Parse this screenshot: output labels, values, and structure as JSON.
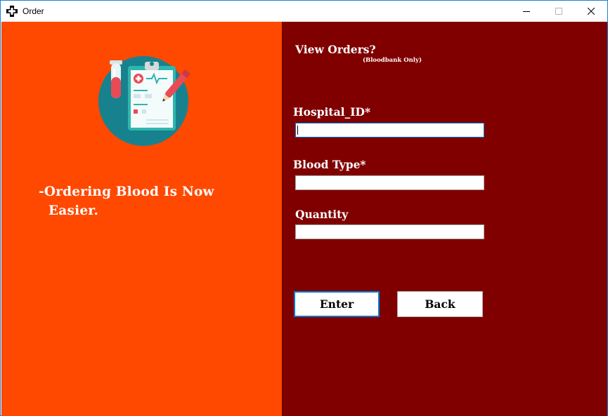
{
  "window": {
    "title": "Order",
    "icon": "medical-cross-icon",
    "controls": [
      "minimize-icon",
      "maximize-icon",
      "close-icon"
    ]
  },
  "left_panel": {
    "background": "#ff4800",
    "illustration": "clipboard-test-tube-icon",
    "tagline_line1": "-Ordering Blood Is Now",
    "tagline_line2": "Easier."
  },
  "right_panel": {
    "background": "#800000",
    "view_orders_label": "View Orders?",
    "view_orders_note": "(Bloodbank Only)",
    "fields": {
      "hospital_id": {
        "label": "Hospital_ID*",
        "value": ""
      },
      "blood_type": {
        "label": "Blood Type*",
        "value": ""
      },
      "quantity": {
        "label": "Quantity",
        "value": ""
      }
    },
    "buttons": {
      "enter": "Enter",
      "back": "Back"
    }
  }
}
